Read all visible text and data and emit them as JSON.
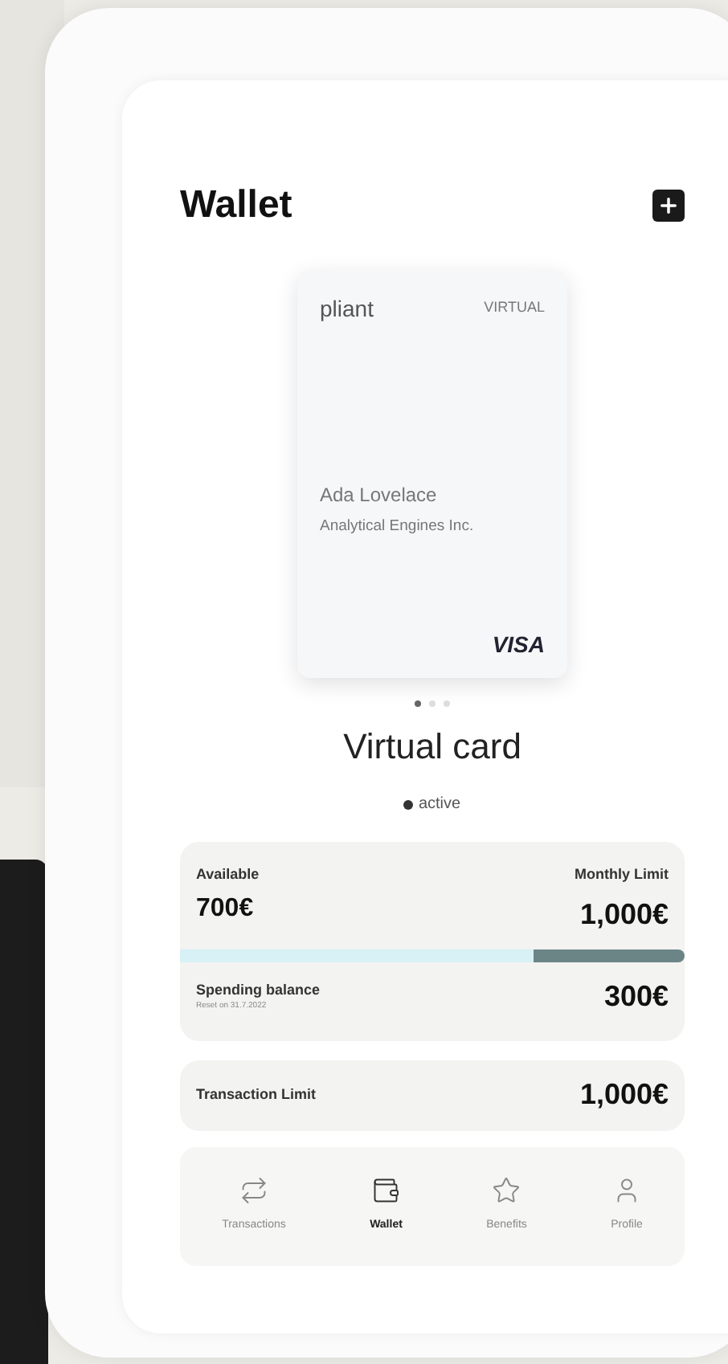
{
  "header": {
    "title": "Wallet"
  },
  "card": {
    "brand": "pliant",
    "type": "VIRTUAL",
    "holder": "Ada Lovelace",
    "company": "Analytical Engines Inc.",
    "network": "VISA"
  },
  "pager": [
    {
      "selected": true
    },
    {
      "selected": false
    },
    {
      "selected": false
    }
  ],
  "card_title": "Virtual card",
  "status": {
    "label": "active",
    "active": true
  },
  "limits": {
    "available_label": "Available",
    "available": "700€",
    "monthly_label": "Monthly Limit",
    "monthly": "1,000€",
    "level": 0.7,
    "balance_label": "Spending balance",
    "reset": "Reset on 31.7.2022",
    "balance": "300€"
  },
  "transaction_limit": {
    "label": "Transaction Limit",
    "value": "1,000€"
  },
  "nav": [
    {
      "kind": "transactions",
      "label": "Transactions",
      "selected": false
    },
    {
      "kind": "wallet",
      "label": "Wallet",
      "selected": true
    },
    {
      "kind": "benefits",
      "label": "Benefits",
      "selected": false
    },
    {
      "kind": "profile",
      "label": "Profile",
      "selected": false
    }
  ]
}
